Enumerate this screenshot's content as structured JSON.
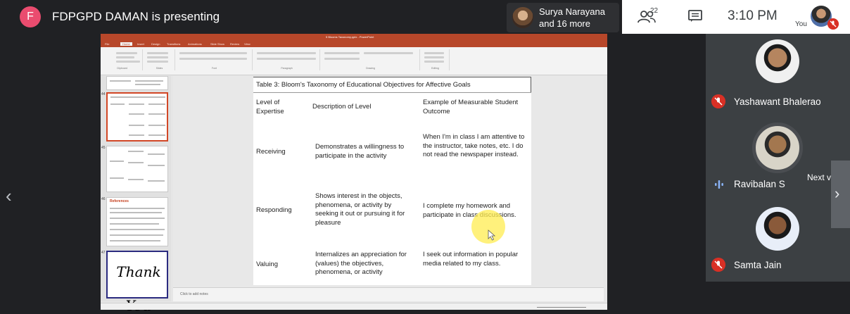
{
  "presenter": {
    "initial": "F",
    "status": "FDPGPD DAMAN is presenting"
  },
  "people": {
    "line1": "Surya Narayana",
    "line2": "and 16 more"
  },
  "toolbar": {
    "participants_count": "22",
    "time": "3:10 PM",
    "you_label": "You"
  },
  "powerpoint": {
    "title": "5 Blooms Taxonomy.pptx - PowerPoint",
    "tabs": [
      "File",
      "Home",
      "Insert",
      "Design",
      "Transitions",
      "Animations",
      "Slide Show",
      "Review",
      "View"
    ],
    "ribbon_groups": [
      "Clipboard",
      "Slides",
      "Font",
      "Paragraph",
      "Drawing",
      "Editing"
    ],
    "thumb_numbers": [
      "44",
      "45",
      "46",
      "47"
    ],
    "references_title": "References",
    "thank_you": "Thank You",
    "notes_placeholder": "Click to add notes"
  },
  "slide_table": {
    "caption": "Table 3: Bloom's Taxonomy of Educational Objectives for Affective Goals",
    "headers": [
      "Level of Expertise",
      "Description of Level",
      "Example of Measurable Student Outcome"
    ],
    "rows": [
      {
        "level": "Receiving",
        "description": "Demonstrates a willingness to participate in the activity",
        "example": "When I'm in class I am attentive to the instructor, take notes, etc. I do not read the newspaper instead."
      },
      {
        "level": "Responding",
        "description": "Shows interest in the objects, phenomena, or activity by seeking it out or pursuing it for pleasure",
        "example": "I complete my homework and participate in class discussions."
      },
      {
        "level": "Valuing",
        "description": "Internalizes an appreciation for (values) the objectives, phenomena, or activity",
        "example": "I seek out information in popular media related to my class."
      }
    ]
  },
  "participants": [
    {
      "name": "Yashawant Bhalerao",
      "muted": true
    },
    {
      "name": "Ravibalan S",
      "muted": false
    },
    {
      "name": "Samta Jain",
      "muted": true
    }
  ],
  "next_video_label": "Next video",
  "colors": {
    "presenter_avatar": "#ea4c6f",
    "ppt_brand": "#b7472a",
    "muted_red": "#d93025",
    "cursor_highlight": "#ffec50",
    "speaking_blue": "#8ab4f8"
  }
}
